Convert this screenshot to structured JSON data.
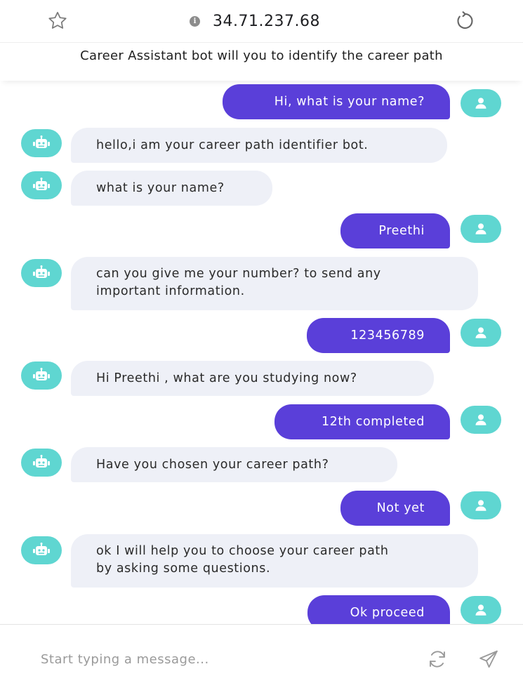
{
  "browser": {
    "url": "34.71.237.68",
    "icons": {
      "bookmark": "star-icon",
      "info": "info-icon",
      "reload": "reload-icon"
    }
  },
  "chat": {
    "title": "Career Assistant bot will you to identify the career path",
    "messages": [
      {
        "sender": "user",
        "text": "Hi, what is your name?"
      },
      {
        "sender": "bot",
        "text": "hello,i am your career path identifier bot."
      },
      {
        "sender": "bot",
        "text": "what is your name?"
      },
      {
        "sender": "user",
        "text": "Preethi"
      },
      {
        "sender": "bot",
        "lines": [
          "can you give me your number? to send any",
          "important information."
        ]
      },
      {
        "sender": "user",
        "text": "123456789"
      },
      {
        "sender": "bot",
        "text": "Hi Preethi , what are you studying now?"
      },
      {
        "sender": "user",
        "text": "12th completed"
      },
      {
        "sender": "bot",
        "text": "Have you chosen your career path?"
      },
      {
        "sender": "user",
        "text": "Not yet"
      },
      {
        "sender": "bot",
        "lines": [
          "ok I will help you to choose your career path",
          "by asking some questions."
        ]
      },
      {
        "sender": "user",
        "text": "Ok proceed"
      }
    ]
  },
  "composer": {
    "placeholder": "Start typing a message...",
    "value": "",
    "icons": {
      "refresh": "refresh-icon",
      "send": "send-icon"
    }
  },
  "colors": {
    "user_bubble": "#5a3fd9",
    "bot_bubble": "#eef0f7",
    "avatar_bg": "#5fd6d1"
  }
}
